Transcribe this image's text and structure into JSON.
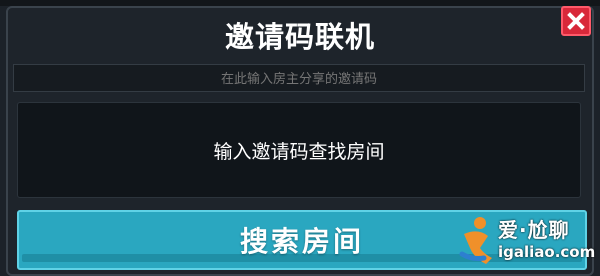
{
  "dialog": {
    "title": "邀请码联机",
    "close_icon": "close-icon",
    "input_placeholder": "在此输入房主分享的邀请码",
    "display_text": "输入邀请码查找房间",
    "search_label": "搜索房间"
  },
  "watermark": {
    "text": "爱·尬聊",
    "url": "igaliao.com"
  },
  "colors": {
    "panel_bg": "#1e242b",
    "close_bg": "#d8283a",
    "search_bg": "#2aa7c0",
    "text": "#ffffff"
  }
}
